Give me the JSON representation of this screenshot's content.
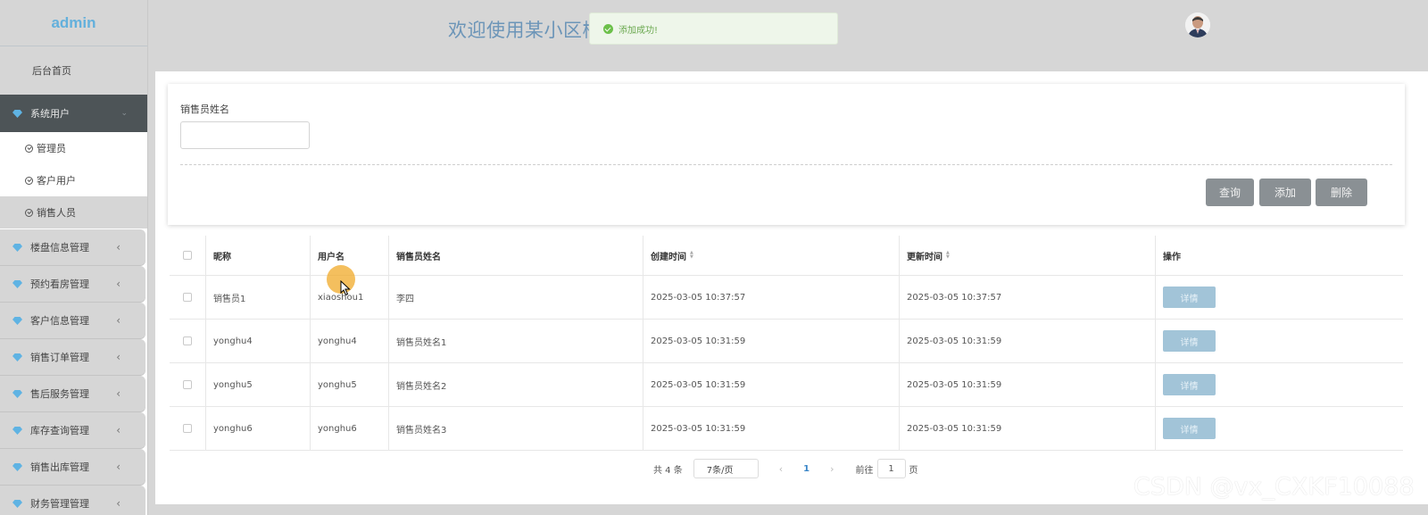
{
  "brand": "admin",
  "sidebar": {
    "home": "后台首页",
    "active_group": "系统用户",
    "sub_items": [
      "管理员",
      "客户用户",
      "销售人员"
    ],
    "groups": [
      "楼盘信息管理",
      "预约看房管理",
      "客户信息管理",
      "销售订单管理",
      "售后服务管理",
      "库存查询管理",
      "销售出库管理",
      "财务管理管理"
    ]
  },
  "header": {
    "title": "欢迎使用某小区楼"
  },
  "toast": {
    "message": "添加成功!"
  },
  "search": {
    "label": "销售员姓名",
    "value": "",
    "buttons": {
      "query": "查询",
      "add": "添加",
      "delete": "删除"
    }
  },
  "table": {
    "headers": [
      "昵称",
      "用户名",
      "销售员姓名",
      "创建时间",
      "更新时间",
      "操作"
    ],
    "rows": [
      {
        "nickname": "销售员1",
        "username": "xiaoshou1",
        "name": "李四",
        "created": "2025-03-05 10:37:57",
        "updated": "2025-03-05 10:37:57",
        "action": "详情"
      },
      {
        "nickname": "yonghu4",
        "username": "yonghu4",
        "name": "销售员姓名1",
        "created": "2025-03-05 10:31:59",
        "updated": "2025-03-05 10:31:59",
        "action": "详情"
      },
      {
        "nickname": "yonghu5",
        "username": "yonghu5",
        "name": "销售员姓名2",
        "created": "2025-03-05 10:31:59",
        "updated": "2025-03-05 10:31:59",
        "action": "详情"
      },
      {
        "nickname": "yonghu6",
        "username": "yonghu6",
        "name": "销售员姓名3",
        "created": "2025-03-05 10:31:59",
        "updated": "2025-03-05 10:31:59",
        "action": "详情"
      }
    ]
  },
  "pagination": {
    "total": "共 4 条",
    "page_size": "7条/页",
    "current_page": "1",
    "goto_label": "前往",
    "goto_value": "1",
    "page_suffix": "页"
  },
  "watermark": "CSDN @vx_CXKF10088",
  "colors": {
    "brand": "#63b0dc",
    "sidebar_active": "#4d5457",
    "button": "#8a9094",
    "detail_button": "#a2c4d8",
    "success": "#6cc04a"
  }
}
